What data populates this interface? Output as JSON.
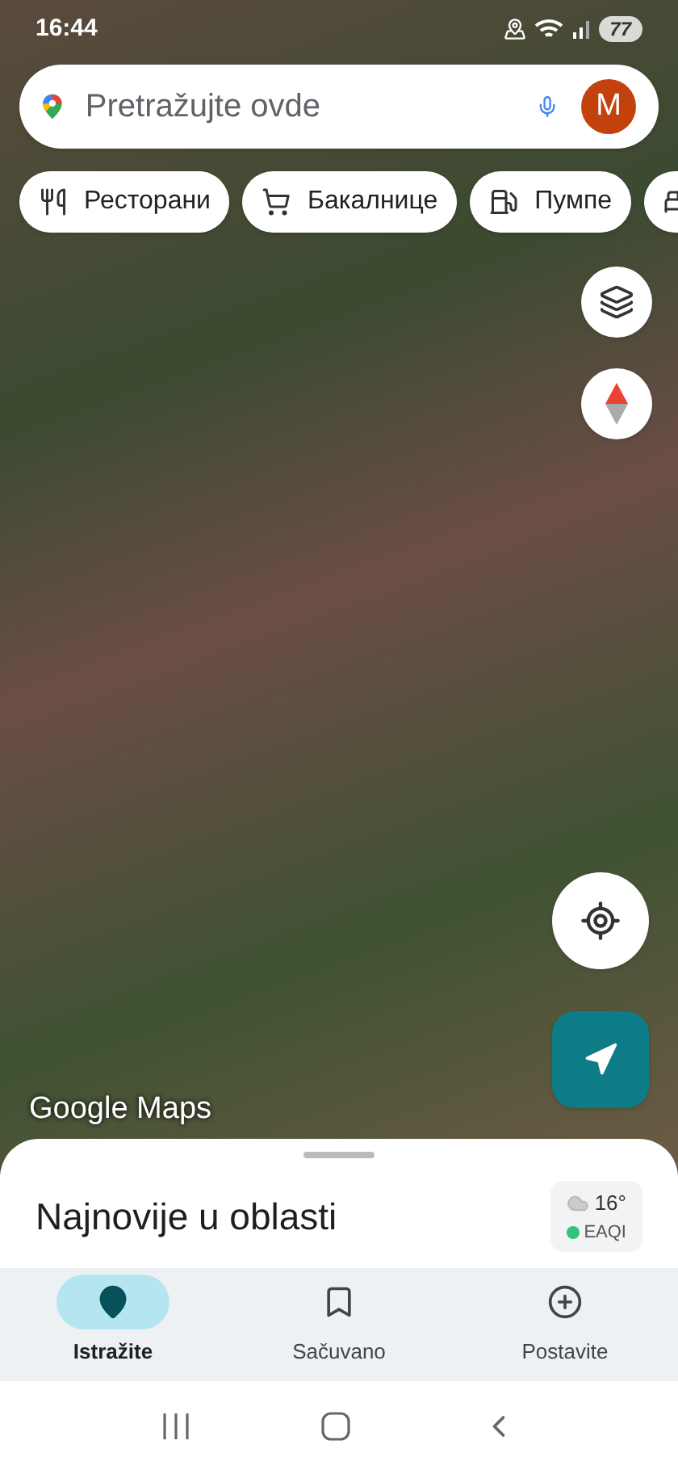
{
  "status_bar": {
    "time": "16:44",
    "battery": "77"
  },
  "search": {
    "placeholder": "Pretražujte ovde",
    "avatar": "M"
  },
  "chips": [
    {
      "kind": "restaurant",
      "label": "Ресторани"
    },
    {
      "kind": "grocery",
      "label": "Бакалнице"
    },
    {
      "kind": "fuel",
      "label": "Пумпе"
    },
    {
      "kind": "hotel"
    }
  ],
  "map": {
    "attribution": "Google Maps"
  },
  "sheet": {
    "title": "Najnovije u oblasti",
    "weather": {
      "temperature": "16°",
      "aqi": "EAQI"
    }
  },
  "nav": [
    {
      "kind": "explore",
      "label": "Istražite",
      "selected": true
    },
    {
      "kind": "saved",
      "label": "Sačuvano",
      "selected": false
    },
    {
      "kind": "contribute",
      "label": "Postavite",
      "selected": false
    }
  ]
}
